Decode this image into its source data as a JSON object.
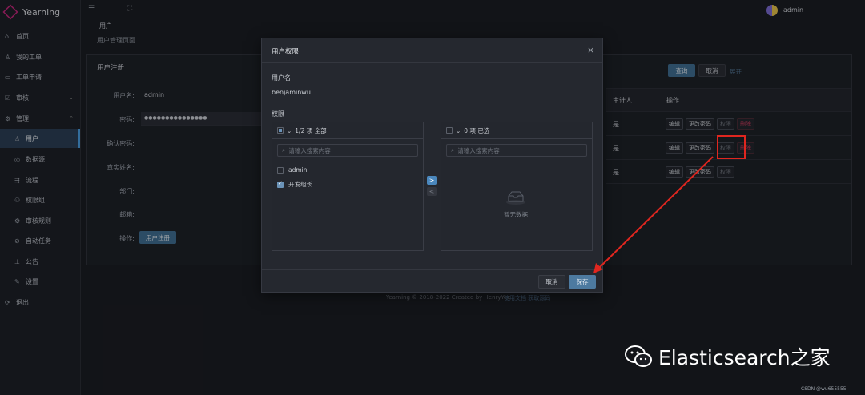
{
  "app": {
    "name": "Yearning",
    "user": "admin"
  },
  "sidebar": {
    "items": [
      {
        "label": "首页",
        "icon": "home-icon"
      },
      {
        "label": "我的工单",
        "icon": "person-icon"
      },
      {
        "label": "工单申请",
        "icon": "ticket-icon"
      },
      {
        "label": "审核",
        "icon": "audit-icon"
      },
      {
        "label": "管理",
        "icon": "gear-icon"
      },
      {
        "label": "用户",
        "icon": "user-icon"
      },
      {
        "label": "数据源",
        "icon": "database-icon"
      },
      {
        "label": "流程",
        "icon": "flow-icon"
      },
      {
        "label": "权限组",
        "icon": "group-icon"
      },
      {
        "label": "审核规则",
        "icon": "rule-icon"
      },
      {
        "label": "自动任务",
        "icon": "task-icon"
      },
      {
        "label": "公告",
        "icon": "chart-icon"
      },
      {
        "label": "设置",
        "icon": "wrench-icon"
      },
      {
        "label": "退出",
        "icon": "logout-icon"
      }
    ]
  },
  "page": {
    "breadcrumb": "用户",
    "subtitle": "用户管理页面",
    "register_panel_title": "用户注册",
    "form": {
      "username_label": "用户名:",
      "username_value": "admin",
      "password_label": "密码:",
      "password_value": "●●●●●●●●●●●●●●●",
      "confirm_label": "确认密码:",
      "realname_label": "真实姓名:",
      "dept_label": "部门:",
      "email_label": "邮箱:",
      "action_label": "操作:",
      "register_button": "用户注册"
    },
    "query_button": "查询",
    "cancel_button": "取消",
    "expand_link": "展开",
    "table": {
      "col_auditor": "审计人",
      "col_ops": "操作",
      "rows": [
        {
          "auditor": "是"
        },
        {
          "auditor": "是"
        },
        {
          "auditor": "是"
        }
      ],
      "op_edit": "编辑",
      "op_change_pwd": "更改密码",
      "op_perm": "权限",
      "op_delete": "删除"
    },
    "footer": "Yearning © 2018-2022 Created by HenryYee",
    "footer_links": "使用文档 获取源码"
  },
  "modal": {
    "title": "用户权限",
    "username_label": "用户名",
    "username_value": "benjaminwu",
    "permission_label": "权限",
    "left_panel": {
      "header": "1/2 项 全部",
      "search_placeholder": "请输入搜索内容",
      "items": [
        {
          "label": "admin",
          "checked": false
        },
        {
          "label": "开发组长",
          "checked": true
        }
      ]
    },
    "right_panel": {
      "header": "0 项 已选",
      "search_placeholder": "请输入搜索内容",
      "empty_text": "暂无数据"
    },
    "move_right": ">",
    "move_left": "<",
    "cancel_button": "取消",
    "save_button": "保存"
  },
  "watermark": {
    "text": "Elasticsearch之家",
    "csdn": "CSDN @wu655555"
  },
  "colors": {
    "accent": "#3f6e91",
    "annotation": "#e0261f",
    "danger": "#c23a5b"
  }
}
